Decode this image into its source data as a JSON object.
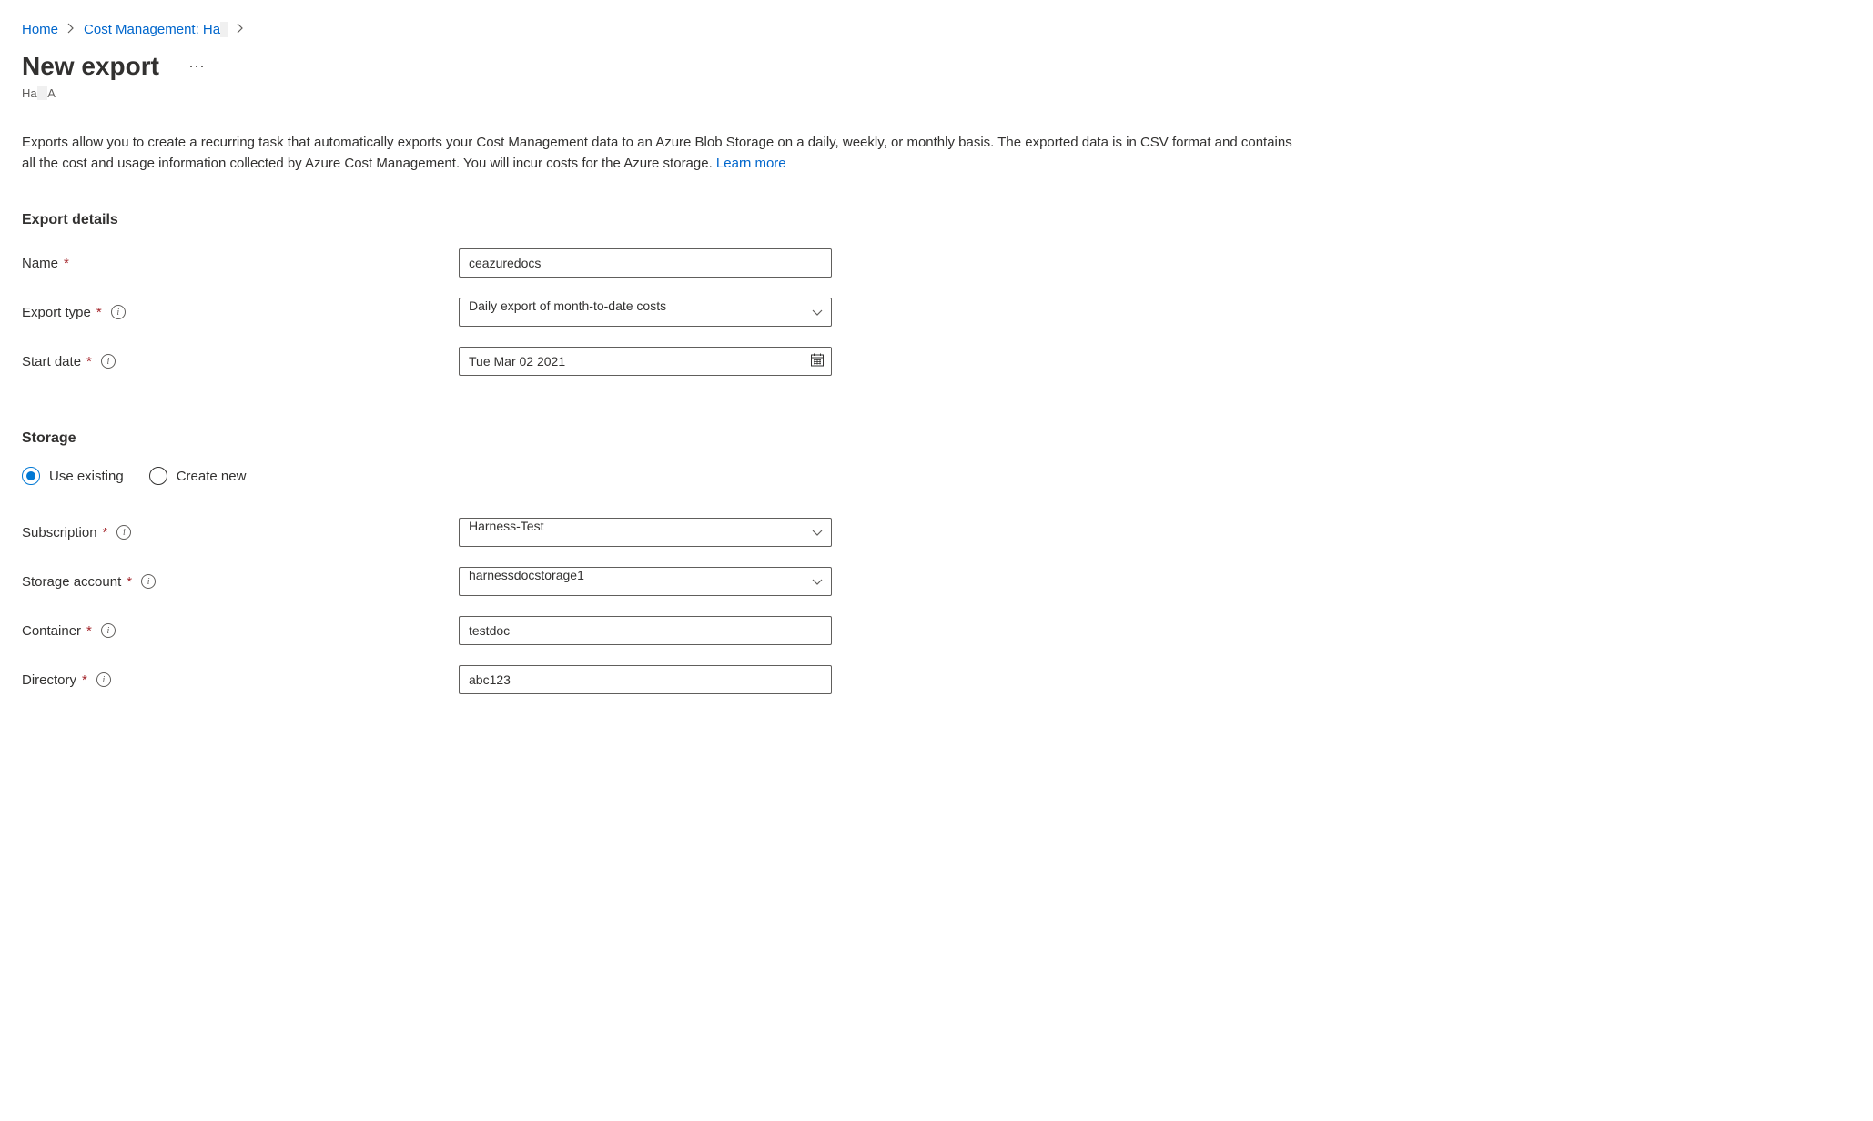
{
  "breadcrumb": {
    "home": "Home",
    "cost_mgmt": "Cost Management: Ha",
    "cost_mgmt_redacted": " "
  },
  "page": {
    "title": "New export",
    "subtitle_prefix": "Ha",
    "subtitle_redacted": "          ",
    "subtitle_suffix": "A",
    "description": "Exports allow you to create a recurring task that automatically exports your Cost Management data to an Azure Blob Storage on a daily, weekly, or monthly basis. The exported data is in CSV format and contains all the cost and usage information collected by Azure Cost Management. You will incur costs for the Azure storage. ",
    "learn_more": "Learn more"
  },
  "sections": {
    "export_details": "Export details",
    "storage": "Storage"
  },
  "labels": {
    "name": "Name",
    "export_type": "Export type",
    "start_date": "Start date",
    "subscription": "Subscription",
    "storage_account": "Storage account",
    "container": "Container",
    "directory": "Directory"
  },
  "radio": {
    "use_existing": "Use existing",
    "create_new": "Create new"
  },
  "values": {
    "name": "ceazuredocs",
    "export_type": "Daily export of month-to-date costs",
    "start_date": "Tue Mar 02 2021",
    "subscription": "Harness-Test",
    "storage_account": "harnessdocstorage1",
    "container": "testdoc",
    "directory": "abc123"
  }
}
